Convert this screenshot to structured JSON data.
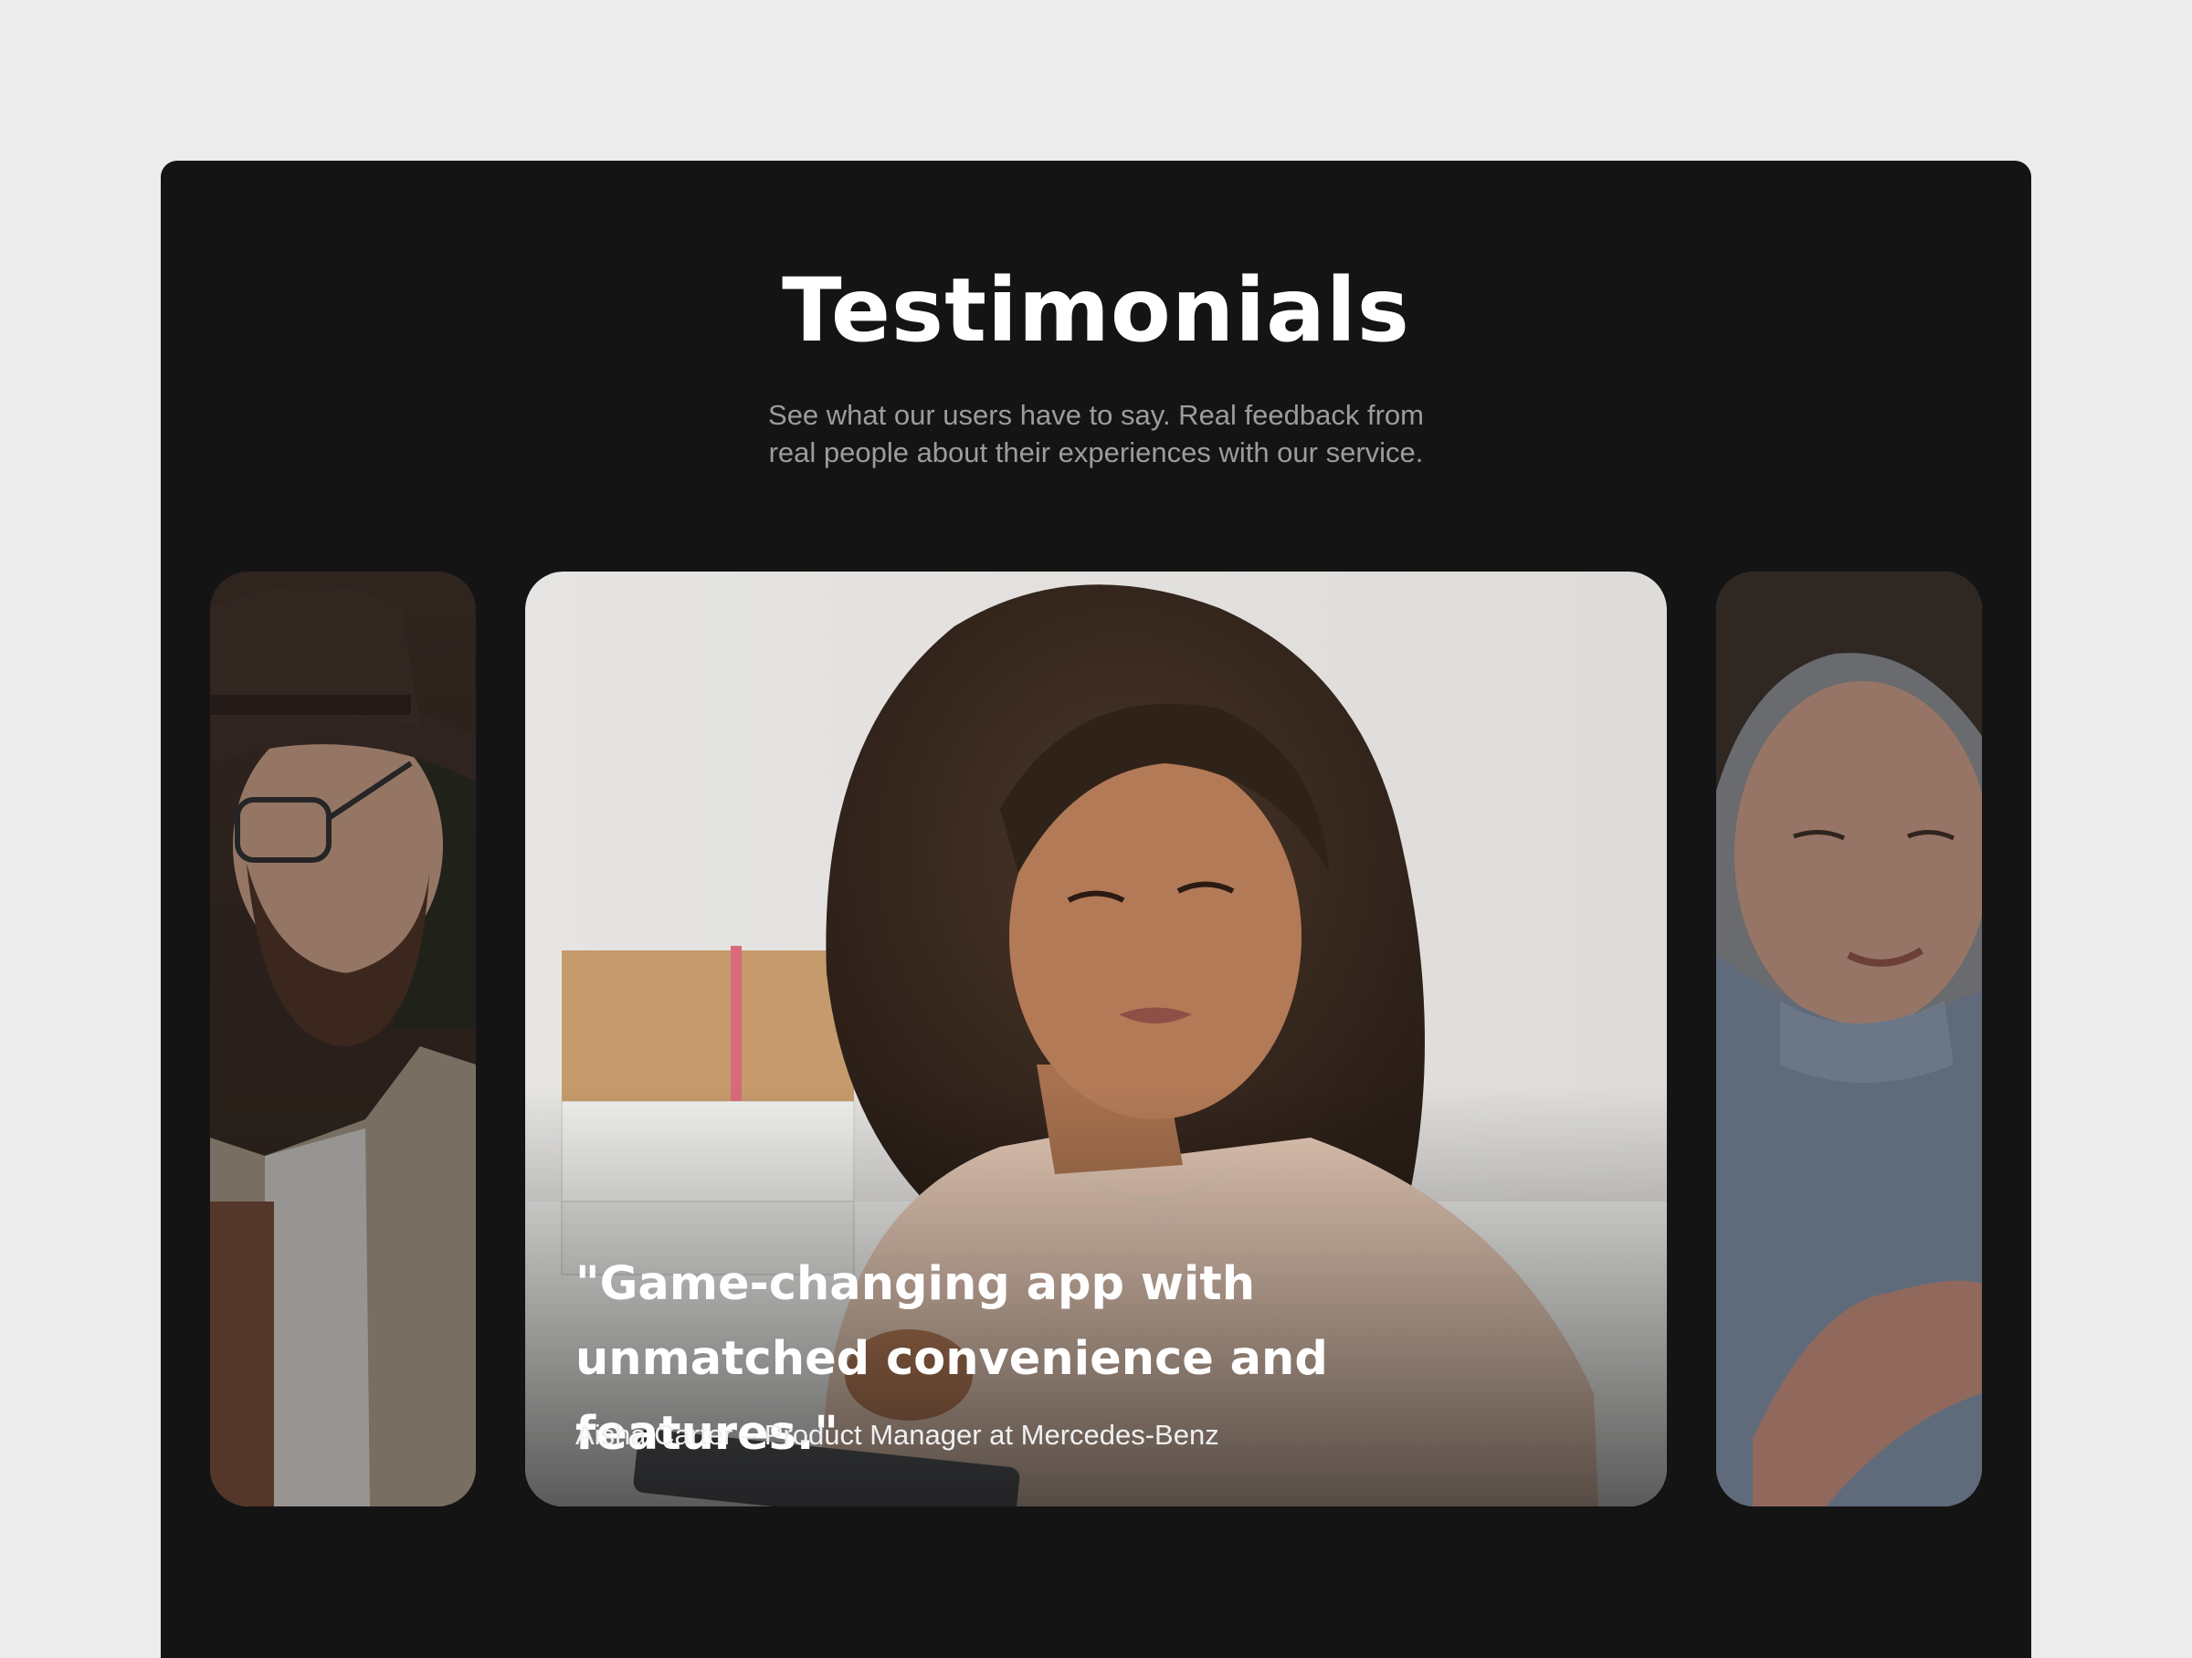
{
  "section": {
    "title": "Testimonials",
    "subtitle": "See what our users have to say. Real feedback from real people about their experiences with our service."
  },
  "testimonials": [
    {
      "position": "left",
      "photo": "man-with-hat-and-glasses-photo"
    },
    {
      "position": "center",
      "photo": "woman-with-curly-hair-using-tablet-photo",
      "quote": "\"Game-changing app with unmatched convenience and features.\"",
      "author": "Aisha Carter – Product Manager at Mercedes-Benz"
    },
    {
      "position": "right",
      "photo": "smiling-woman-in-blue-blouse-photo"
    }
  ],
  "colors": {
    "page_background": "#ececec",
    "panel_background": "#141414",
    "title": "#ffffff",
    "subtitle": "#9c9c9c"
  }
}
